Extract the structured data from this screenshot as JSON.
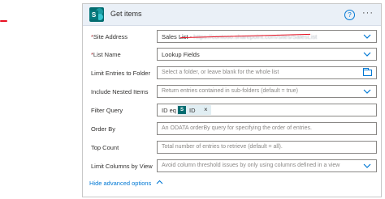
{
  "card": {
    "title": "Get items",
    "icon": "sharepoint-icon",
    "help_icon": "question-circle-icon",
    "help_glyph": "?",
    "more_icon": "more-options-icon",
    "more_glyph": "···"
  },
  "fields": {
    "site_address": {
      "required_mark": "*",
      "label": "Site Address",
      "value_prefix": "Sales List - ",
      "value_blurred": "https://contoso.sharepoint.com/sites/SalesList",
      "value_suffix": ""
    },
    "list_name": {
      "required_mark": "*",
      "label": "List Name",
      "value": "Lookup Fields"
    },
    "limit_entries": {
      "label": "Limit Entries to Folder",
      "placeholder": "Select a folder, or leave blank for the whole list"
    },
    "nested_items": {
      "label": "Include Nested Items",
      "placeholder": "Return entries contained in sub-folders (default = true)"
    },
    "filter_query": {
      "label": "Filter Query",
      "prefix": "ID eq",
      "token_label": "ID",
      "token_remove": "×"
    },
    "order_by": {
      "label": "Order By",
      "placeholder": "An ODATA orderBy query for specifying the order of entries."
    },
    "top_count": {
      "label": "Top Count",
      "placeholder": "Total number of entries to retrieve (default = all)."
    },
    "limit_columns": {
      "label": "Limit Columns by View",
      "placeholder": "Avoid column threshold issues by only using columns defined in a view"
    }
  },
  "advanced": {
    "label": "Hide advanced options",
    "icon": "chevron-up-icon"
  },
  "colors": {
    "accent": "#0078d4",
    "required": "#a4262c",
    "sharepoint": "#036c70",
    "header_bg": "#eaf0f7",
    "annotation": "#e81123"
  }
}
